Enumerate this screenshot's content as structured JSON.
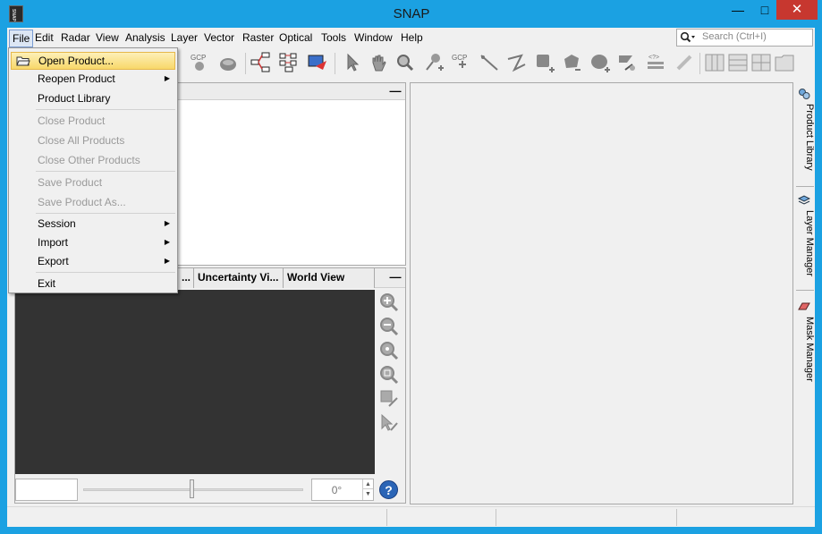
{
  "window": {
    "title": "SNAP",
    "app_icon_text": "SNAP",
    "minimize_glyph": "—",
    "maximize_glyph": "□",
    "close_glyph": "✕"
  },
  "menubar": {
    "items": [
      "File",
      "Edit",
      "Radar",
      "View",
      "Analysis",
      "Layer",
      "Vector",
      "Raster",
      "Optical",
      "Tools",
      "Window",
      "Help"
    ],
    "search_placeholder": "Search (Ctrl+I)",
    "search_icon": "magnifier-icon"
  },
  "file_menu": {
    "open_product": "Open Product...",
    "reopen_product": "Reopen Product",
    "product_library": "Product Library",
    "close_product": "Close Product",
    "close_all_products": "Close All Products",
    "close_other_products": "Close Other Products",
    "save_product": "Save Product",
    "save_product_as": "Save Product As...",
    "session": "Session",
    "import": "Import",
    "export": "Export",
    "exit": "Exit",
    "submenu_arrow": "▶"
  },
  "toolbar": {
    "gcp_label": "GCP"
  },
  "bottom_panel": {
    "tabs": [
      "...",
      "Uncertainty Vi...",
      "World View"
    ],
    "minimize_glyph": "—",
    "angle_value": "0°",
    "spin_up": "▲",
    "spin_down": "▼",
    "help_glyph": "?"
  },
  "top_panel": {
    "minimize_glyph": "—"
  },
  "right_sidebar": {
    "tabs": [
      "Product Library",
      "Layer Manager",
      "Mask Manager"
    ]
  }
}
